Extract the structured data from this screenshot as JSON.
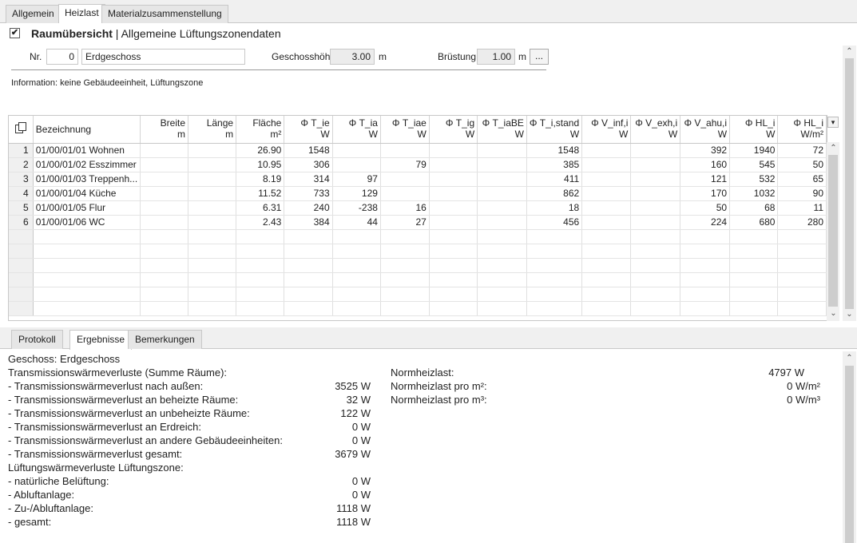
{
  "tabs": [
    "Allgemein",
    "Heizlast",
    "Materialzusammenstellung"
  ],
  "active_tab": "Heizlast",
  "header": {
    "checkbox_mark": "✔",
    "title_bold": "Raumübersicht",
    "title_sep": " | ",
    "title_rest": "Allgemeine Lüftungszonendaten"
  },
  "form": {
    "nr_label": "Nr.",
    "nr_value": "0",
    "name_value": "Erdgeschoss",
    "height_label": "Geschosshöhe",
    "height_value": "3.00",
    "height_unit": "m",
    "sill_label": "Brüstung",
    "sill_value": "1.00",
    "sill_unit": "m",
    "more_button": "..."
  },
  "info": "Information: keine Gebäudeeinheit, Lüftungszone",
  "grid": {
    "copy_icon": "copy-icon",
    "columns": [
      {
        "name": "Bezeichnung",
        "unit": ""
      },
      {
        "name": "Breite",
        "unit": "m"
      },
      {
        "name": "Länge",
        "unit": "m"
      },
      {
        "name": "Fläche",
        "unit": "m²"
      },
      {
        "name": "Φ T_ie",
        "unit": "W"
      },
      {
        "name": "Φ T_ia",
        "unit": "W"
      },
      {
        "name": "Φ T_iae",
        "unit": "W"
      },
      {
        "name": "Φ T_ig",
        "unit": "W"
      },
      {
        "name": "Φ T_iaBE",
        "unit": "W"
      },
      {
        "name": "Φ T_i,stand",
        "unit": "W"
      },
      {
        "name": "Φ V_inf,i",
        "unit": "W"
      },
      {
        "name": "Φ V_exh,i",
        "unit": "W"
      },
      {
        "name": "Φ V_ahu,i",
        "unit": "W"
      },
      {
        "name": "Φ HL_i",
        "unit": "W"
      },
      {
        "name": "Φ HL_i",
        "unit": "W/m²"
      }
    ],
    "rows": [
      {
        "idx": "1",
        "cells": [
          "01/00/01/01 Wohnen",
          "",
          "",
          "26.90",
          "1548",
          "",
          "",
          "",
          "",
          "1548",
          "",
          "",
          "392",
          "1940",
          "72"
        ]
      },
      {
        "idx": "2",
        "cells": [
          "01/00/01/02 Esszimmer",
          "",
          "",
          "10.95",
          "306",
          "",
          "79",
          "",
          "",
          "385",
          "",
          "",
          "160",
          "545",
          "50"
        ]
      },
      {
        "idx": "3",
        "cells": [
          "01/00/01/03 Treppenh...",
          "",
          "",
          "8.19",
          "314",
          "97",
          "",
          "",
          "",
          "411",
          "",
          "",
          "121",
          "532",
          "65"
        ]
      },
      {
        "idx": "4",
        "cells": [
          "01/00/01/04 Küche",
          "",
          "",
          "11.52",
          "733",
          "129",
          "",
          "",
          "",
          "862",
          "",
          "",
          "170",
          "1032",
          "90"
        ]
      },
      {
        "idx": "5",
        "cells": [
          "01/00/01/05 Flur",
          "",
          "",
          "6.31",
          "240",
          "-238",
          "16",
          "",
          "",
          "18",
          "",
          "",
          "50",
          "68",
          "11"
        ]
      },
      {
        "idx": "6",
        "cells": [
          "01/00/01/06 WC",
          "",
          "",
          "2.43",
          "384",
          "44",
          "27",
          "",
          "",
          "456",
          "",
          "",
          "224",
          "680",
          "280"
        ]
      }
    ],
    "empty_rows": 6
  },
  "bottom_tabs": [
    "Protokoll",
    "Ergebnisse",
    "Bemerkungen"
  ],
  "bottom_active_tab": "Ergebnisse",
  "results": {
    "left": [
      {
        "label": "Geschoss: Erdgeschoss",
        "value": ""
      },
      {
        "label": "Transmissionswärmeverluste (Summe Räume):",
        "value": ""
      },
      {
        "label": "- Transmissionswärmeverlust nach außen:",
        "value": "3525 W"
      },
      {
        "label": "- Transmissionswärmeverlust an beheizte Räume:",
        "value": "32 W"
      },
      {
        "label": "- Transmissionswärmeverlust an unbeheizte Räume:",
        "value": "122 W"
      },
      {
        "label": "- Transmissionswärmeverlust an Erdreich:",
        "value": "0 W"
      },
      {
        "label": "- Transmissionswärmeverlust an andere Gebäudeeinheiten:",
        "value": "0 W"
      },
      {
        "label": "- Transmissionswärmeverlust gesamt:",
        "value": "3679 W"
      },
      {
        "label": "Lüftungswärmeverluste Lüftungszone:",
        "value": ""
      },
      {
        "label": "- natürliche Belüftung:",
        "value": "0 W"
      },
      {
        "label": "- Abluftanlage:",
        "value": "0 W"
      },
      {
        "label": "- Zu-/Abluftanlage:",
        "value": "1118 W"
      },
      {
        "label": "- gesamt:",
        "value": "1118 W"
      }
    ],
    "right": [
      {
        "label": "Normheizlast:",
        "value": "4797 W"
      },
      {
        "label": "Normheizlast pro m²:",
        "value": "0 W/m²"
      },
      {
        "label": "Normheizlast pro m³:",
        "value": "0 W/m³"
      }
    ]
  },
  "colors": {
    "tab_bg": "#e6e6e6",
    "grid_index_bg": "#f0f0f0",
    "scrollbar_thumb": "#cdcdcd"
  }
}
